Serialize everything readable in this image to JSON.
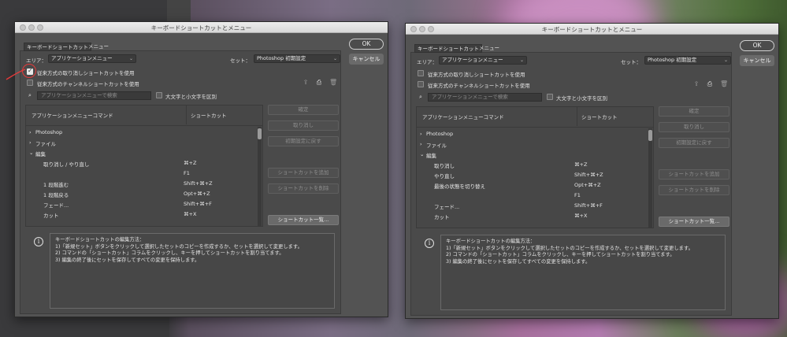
{
  "left": {
    "title": "キーボードショートカットとメニュー",
    "tabs": [
      "キーボードショートカット",
      "メニュー"
    ],
    "area_label": "エリア：",
    "area_value": "アプリケーションメニュー",
    "set_label": "セット：",
    "set_value": "Photoshop 初期設定",
    "legacy_undo_label": "従来方式の取り消しショートカットを使用",
    "legacy_undo_checked": true,
    "legacy_channel_label": "従来方式のチャンネルショートカットを使用",
    "legacy_channel_checked": false,
    "search_placeholder": "アプリケーションメニューで検索",
    "case_label": "大文字と小文字を区別",
    "col_command": "アプリケーションメニューコマンド",
    "col_shortcut": "ショートカット",
    "rows": [
      {
        "name": "Photoshop",
        "shortcut": "",
        "expander": "›"
      },
      {
        "name": "ファイル",
        "shortcut": "",
        "expander": "›"
      },
      {
        "name": "編集",
        "shortcut": "",
        "expander": "⌄"
      },
      {
        "name": "取り消し / やり直し",
        "shortcut": "⌘+Z",
        "expander": ""
      },
      {
        "name": "",
        "shortcut": "F1",
        "expander": ""
      },
      {
        "name": "1 段階進む",
        "shortcut": "Shift+⌘+Z",
        "expander": ""
      },
      {
        "name": "1 段階戻る",
        "shortcut": "Opt+⌘+Z",
        "expander": ""
      },
      {
        "name": "フェード...",
        "shortcut": "Shift+⌘+F",
        "expander": ""
      },
      {
        "name": "カット",
        "shortcut": "⌘+X",
        "expander": ""
      },
      {
        "name": "",
        "shortcut": "__",
        "expander": ""
      }
    ],
    "buttons": {
      "ok": "OK",
      "cancel": "キャンセル",
      "accept": "確定",
      "undo": "取り消し",
      "reset": "初期設定に戻す",
      "add_shortcut": "ショートカットを追加",
      "delete_shortcut": "ショートカットを削除",
      "summarize": "ショートカット一覧..."
    },
    "info_lines": [
      "キーボードショートカットの編集方法：",
      "1)「新規セット」ボタンをクリックして選択したセットのコピーを作成するか、セットを選択して変更します。",
      "2) コマンドの「ショートカット」コラムをクリックし、キーを押してショートカットを割り当てます。",
      "3) 編集の終了後にセットを保存してすべての変更を保持します。"
    ]
  },
  "right": {
    "title": "キーボードショートカットとメニュー",
    "tabs": [
      "キーボードショートカット",
      "メニュー"
    ],
    "area_label": "エリア：",
    "area_value": "アプリケーションメニュー",
    "set_label": "セット：",
    "set_value": "Photoshop 初期設定",
    "legacy_undo_label": "従来方式の取り消しショートカットを使用",
    "legacy_undo_checked": false,
    "legacy_channel_label": "従来方式のチャンネルショートカットを使用",
    "legacy_channel_checked": false,
    "search_placeholder": "アプリケーションメニューで検索",
    "case_label": "大文字と小文字を区別",
    "col_command": "アプリケーションメニューコマンド",
    "col_shortcut": "ショートカット",
    "rows": [
      {
        "name": "Photoshop",
        "shortcut": "",
        "expander": "›"
      },
      {
        "name": "ファイル",
        "shortcut": "",
        "expander": "›"
      },
      {
        "name": "編集",
        "shortcut": "",
        "expander": "⌄"
      },
      {
        "name": "取り消し",
        "shortcut": "⌘+Z",
        "expander": ""
      },
      {
        "name": "やり直し",
        "shortcut": "Shift+⌘+Z",
        "expander": ""
      },
      {
        "name": "最後の状態を切り替え",
        "shortcut": "Opt+⌘+Z",
        "expander": ""
      },
      {
        "name": "",
        "shortcut": "F1",
        "expander": ""
      },
      {
        "name": "フェード...",
        "shortcut": "Shift+⌘+F",
        "expander": ""
      },
      {
        "name": "カット",
        "shortcut": "⌘+X",
        "expander": ""
      }
    ],
    "buttons": {
      "ok": "OK",
      "cancel": "キャンセル",
      "accept": "確定",
      "undo": "取り消し",
      "reset": "初期設定に戻す",
      "add_shortcut": "ショートカットを追加",
      "delete_shortcut": "ショートカットを削除",
      "summarize": "ショートカット一覧..."
    },
    "info_lines": [
      "キーボードショートカットの編集方法：",
      "1)「新規セット」ボタンをクリックして選択したセットのコピーを作成するか、セットを選択して変更します。",
      "2) コマンドの「ショートカット」コラムをクリックし、キーを押してショートカットを割り当てます。",
      "3) 編集の終了後にセットを保存してすべての変更を保持します。"
    ]
  },
  "colors": {
    "dialog_bg": "#535353",
    "annotation_red": "#e43a3a"
  }
}
